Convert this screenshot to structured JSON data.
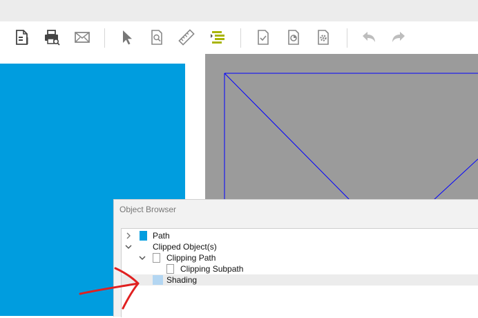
{
  "toolbar": {
    "buttons": [
      {
        "name": "document-properties-icon"
      },
      {
        "name": "print-preview-icon"
      },
      {
        "name": "email-icon"
      },
      {
        "name": "select-tool-icon"
      },
      {
        "name": "zoom-page-icon"
      },
      {
        "name": "ruler-icon"
      },
      {
        "name": "object-browser-icon"
      },
      {
        "name": "document-check-icon"
      },
      {
        "name": "document-color-icon"
      },
      {
        "name": "document-settings-icon"
      },
      {
        "name": "undo-icon"
      },
      {
        "name": "redo-icon"
      }
    ]
  },
  "object_browser": {
    "title": "Object Browser",
    "items": [
      {
        "label": "Path",
        "swatch": "#009ddf"
      },
      {
        "label": "Clipped Object(s)"
      },
      {
        "label": "Clipping Path",
        "swatch": "#ffffff"
      },
      {
        "label": "Clipping Subpath",
        "swatch": "#ffffff"
      },
      {
        "label": "Shading",
        "swatch": "#b3d6f2",
        "selected": true
      }
    ]
  },
  "colors": {
    "canvas_blue": "#009ddf",
    "canvas_gray": "#9b9b9b",
    "wireframe": "#0000ff",
    "annotation": "#e02020",
    "toolbar_accent": "#a8b400"
  }
}
